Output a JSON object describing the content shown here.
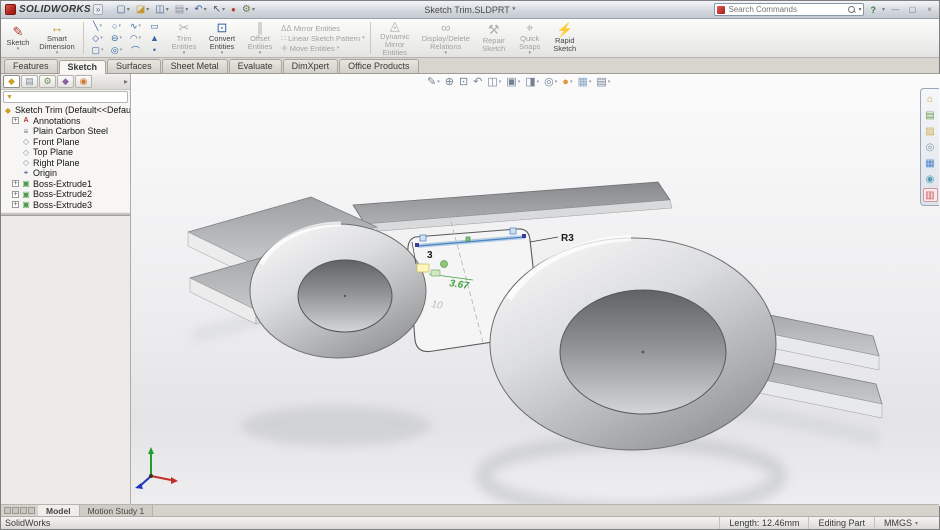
{
  "window": {
    "app_name": "SOLIDWORKS",
    "document_title": "Sketch Trim.SLDPRT *",
    "search_placeholder": "Search Commands"
  },
  "icons": {
    "dropdown": "▾",
    "menu_expand": "»",
    "help": "?",
    "minimize": "—",
    "restore": "▢",
    "close": "×",
    "filter_funnel": "▼",
    "expander": "+",
    "collapse_arrow": "▸"
  },
  "quickbar": {
    "items": [
      {
        "name": "new-document",
        "glyph": "▢"
      },
      {
        "name": "open-document",
        "glyph": "◪"
      },
      {
        "name": "save-document",
        "glyph": "◫"
      },
      {
        "name": "print-document",
        "glyph": "▤"
      },
      {
        "name": "undo",
        "glyph": "↶"
      },
      {
        "name": "select",
        "glyph": "↖"
      },
      {
        "name": "rebuild",
        "glyph": "●"
      },
      {
        "name": "options",
        "glyph": "⚙"
      }
    ]
  },
  "ribbon": {
    "sketch": "Sketch",
    "smart_dimension": "Smart Dimension",
    "trim": "Trim Entities",
    "convert": "Convert Entities",
    "offset": "Offset Entities",
    "mirror": "Mirror Entities",
    "linear_pattern": "Linear Sketch Pattern",
    "move": "Move Entities",
    "dynamic_mirror": "Dynamic Mirror Entities",
    "display_delete": "Display/Delete Relations",
    "repair": "Repair Sketch",
    "quick_snaps": "Quick Snaps",
    "rapid_sketch": "Rapid Sketch",
    "glyphs": {
      "sketch": "✎",
      "smart_dimension": "↔",
      "trim": "✂",
      "convert": "⊡",
      "offset": "∥",
      "mirror": "ΔΔ",
      "linear_pattern": "∷",
      "move": "✛",
      "dynamic_mirror": "◬",
      "display_delete": "∞",
      "repair": "⚒",
      "quick_snaps": "⌖",
      "rapid_sketch": "⚡",
      "line": "╲",
      "circle": "○",
      "spline": "∿",
      "rectangle": "▭",
      "polygon": "◇",
      "slot": "⊖",
      "arc": "◠",
      "fillet": "▲",
      "centerpoint_rectangle": "▢",
      "centerpoint_arc": "◎",
      "tangent_arc": "⌒",
      "point": "•"
    }
  },
  "tabs": {
    "items": [
      "Features",
      "Sketch",
      "Surfaces",
      "Sheet Metal",
      "Evaluate",
      "DimXpert",
      "Office Products"
    ],
    "active": "Sketch"
  },
  "fm": {
    "root": "Sketch Trim (Default<<Default>_",
    "items": [
      "Annotations",
      "Plain Carbon Steel",
      "Front Plane",
      "Top Plane",
      "Right Plane",
      "Origin",
      "Boss-Extrude1",
      "Boss-Extrude2",
      "Boss-Extrude3"
    ],
    "tree_glyphs": {
      "part": "◆",
      "annotations": "A",
      "material": "≡",
      "plane": "◇",
      "origin": "⌖",
      "extrude": "▣"
    },
    "manager_tabs": [
      {
        "name": "feature-manager",
        "glyph": "◆"
      },
      {
        "name": "property-manager",
        "glyph": "▤"
      },
      {
        "name": "configuration-manager",
        "glyph": "⚙"
      },
      {
        "name": "dimxpert-manager",
        "glyph": "◆"
      },
      {
        "name": "display-manager",
        "glyph": "◉"
      }
    ]
  },
  "headsup": {
    "items": [
      {
        "name": "sketch-tool",
        "glyph": "✎"
      },
      {
        "name": "zoom-to-fit",
        "glyph": "⊕"
      },
      {
        "name": "zoom-to-area",
        "glyph": "⊡"
      },
      {
        "name": "previous-view",
        "glyph": "↶"
      },
      {
        "name": "section-view",
        "glyph": "◫"
      },
      {
        "name": "view-orientation",
        "glyph": "▣"
      },
      {
        "name": "display-style",
        "glyph": "◨"
      },
      {
        "name": "hide-show-items",
        "glyph": "◎"
      },
      {
        "name": "edit-appearance",
        "glyph": "●"
      },
      {
        "name": "apply-scene",
        "glyph": "▦"
      },
      {
        "name": "view-settings",
        "glyph": "▤"
      }
    ]
  },
  "taskpane": {
    "items": [
      {
        "name": "solidworks-resources",
        "glyph": "⌂"
      },
      {
        "name": "design-library",
        "glyph": "▤"
      },
      {
        "name": "file-explorer",
        "glyph": "▨"
      },
      {
        "name": "search-results",
        "glyph": "◎"
      },
      {
        "name": "view-palette",
        "glyph": "▦"
      },
      {
        "name": "appearances-scenes",
        "glyph": "◉"
      },
      {
        "name": "custom-properties",
        "glyph": "▥"
      }
    ]
  },
  "viewport": {
    "dim_3": "3",
    "dim_r3": "R3",
    "dim_367": "3.67",
    "dim_10": "10"
  },
  "bottom": {
    "tabs": [
      "Model",
      "Motion Study 1"
    ]
  },
  "status": {
    "app": "SolidWorks",
    "length": "Length: 12.46mm",
    "mode": "Editing Part",
    "units": "MMGS"
  }
}
